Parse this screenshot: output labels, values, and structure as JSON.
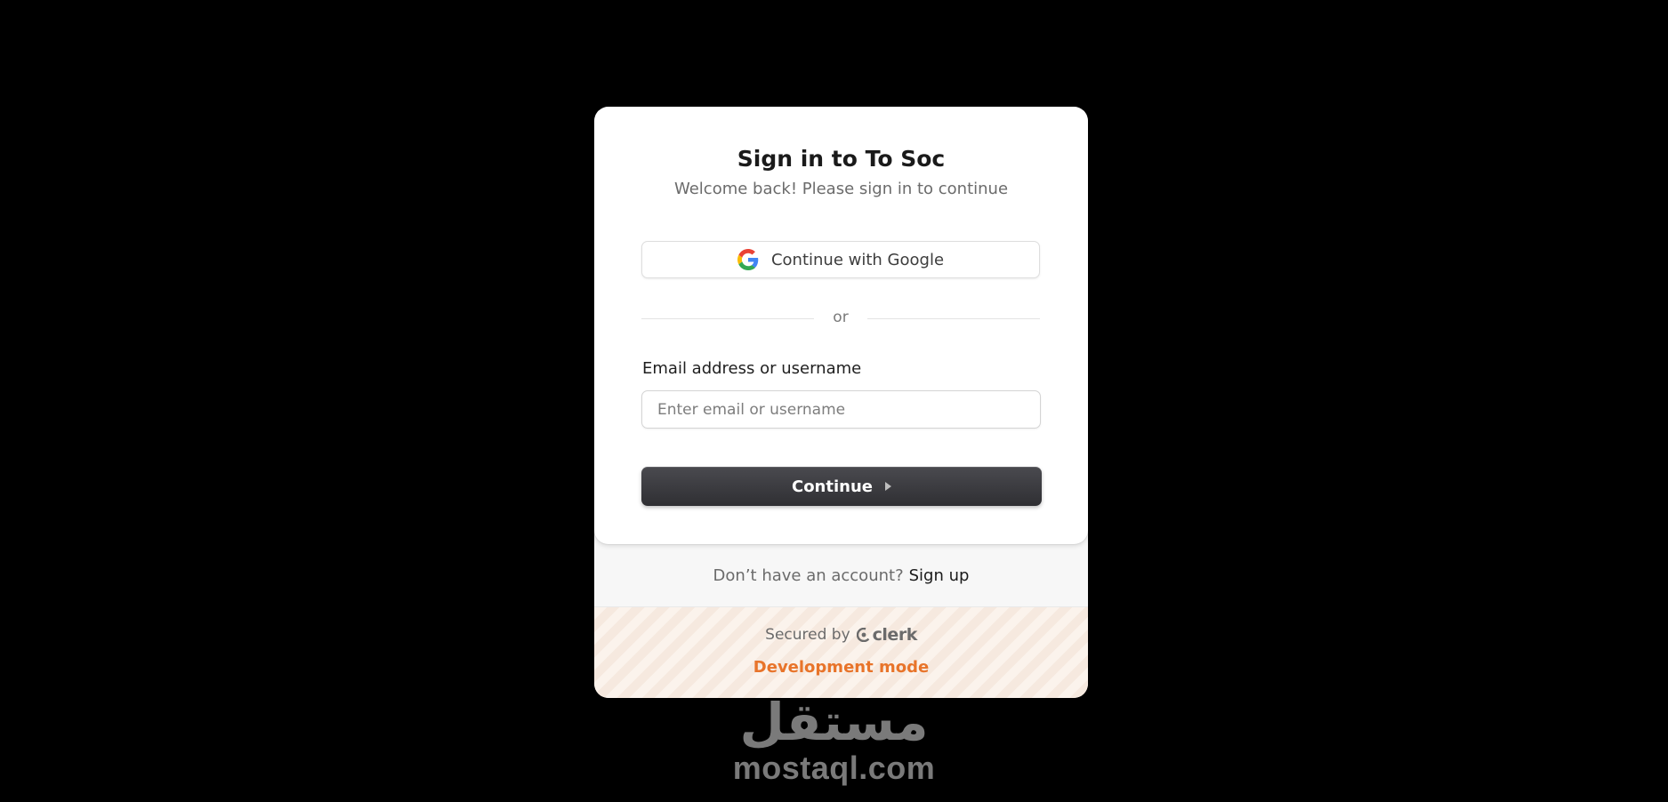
{
  "signin": {
    "title": "Sign in to To Soc",
    "subtitle": "Welcome back! Please sign in to continue",
    "google_button_label": "Continue with Google",
    "divider_text": "or",
    "email_label": "Email address or username",
    "email_placeholder": "Enter email or username",
    "email_value": "",
    "continue_label": "Continue"
  },
  "signup": {
    "prompt": "Don’t have an account?",
    "link_label": "Sign up"
  },
  "footer": {
    "secured_by": "Secured by",
    "brand": "clerk",
    "dev_mode": "Development mode"
  },
  "watermark": {
    "arabic": "مستقل",
    "latin": "mostaql.com"
  },
  "colors": {
    "background": "#000000",
    "card": "#ffffff",
    "primary_button": "#3a3a3e",
    "dev_mode": "#e8742a"
  },
  "icons": {
    "google": "google-icon",
    "continue": "caret-right-icon",
    "clerk": "clerk-logo-icon"
  }
}
